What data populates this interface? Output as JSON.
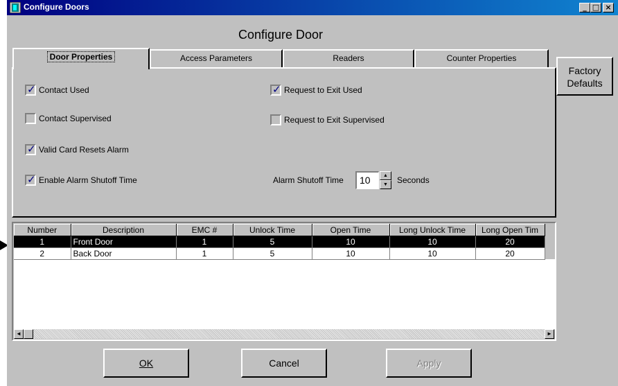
{
  "window": {
    "title": "Configure Doors",
    "controls": {
      "minimize": "_",
      "maximize": "□",
      "close": "×"
    }
  },
  "heading": "Configure Door",
  "tabs": [
    {
      "label": "Door Properties",
      "active": true
    },
    {
      "label": "Access Parameters"
    },
    {
      "label": "Readers"
    },
    {
      "label": "Counter Properties"
    }
  ],
  "door_properties": {
    "contact_used": {
      "label": "Contact Used",
      "checked": true
    },
    "contact_supervised": {
      "label": "Contact Supervised",
      "checked": false
    },
    "valid_card_resets_alarm": {
      "label": "Valid Card Resets Alarm",
      "checked": true
    },
    "enable_alarm_shutoff_time": {
      "label": "Enable Alarm Shutoff Time",
      "checked": true
    },
    "request_to_exit_used": {
      "label": "Request to Exit Used",
      "checked": true
    },
    "request_to_exit_supervised": {
      "label": "Request to Exit Supervised",
      "checked": false
    },
    "alarm_shutoff": {
      "label": "Alarm Shutoff Time",
      "value": "10",
      "unit": "Seconds"
    }
  },
  "side": {
    "factory_defaults_line1": "Factory",
    "factory_defaults_line2": "Defaults"
  },
  "grid": {
    "columns": [
      "Number",
      "Description",
      "EMC #",
      "Unlock Time",
      "Open Time",
      "Long Unlock Time",
      "Long Open Tim"
    ],
    "rows": [
      {
        "number": "1",
        "description": "Front Door",
        "emc": "1",
        "unlock": "5",
        "open": "10",
        "long_unlock": "10",
        "long_open": "20",
        "selected": true
      },
      {
        "number": "2",
        "description": "Back Door",
        "emc": "1",
        "unlock": "5",
        "open": "10",
        "long_unlock": "10",
        "long_open": "20",
        "selected": false
      }
    ]
  },
  "buttons": {
    "ok": "OK",
    "cancel": "Cancel",
    "apply": "Apply"
  },
  "icons": {
    "scroll_left": "◄",
    "scroll_right": "►",
    "spin_up": "▲",
    "spin_down": "▼"
  }
}
